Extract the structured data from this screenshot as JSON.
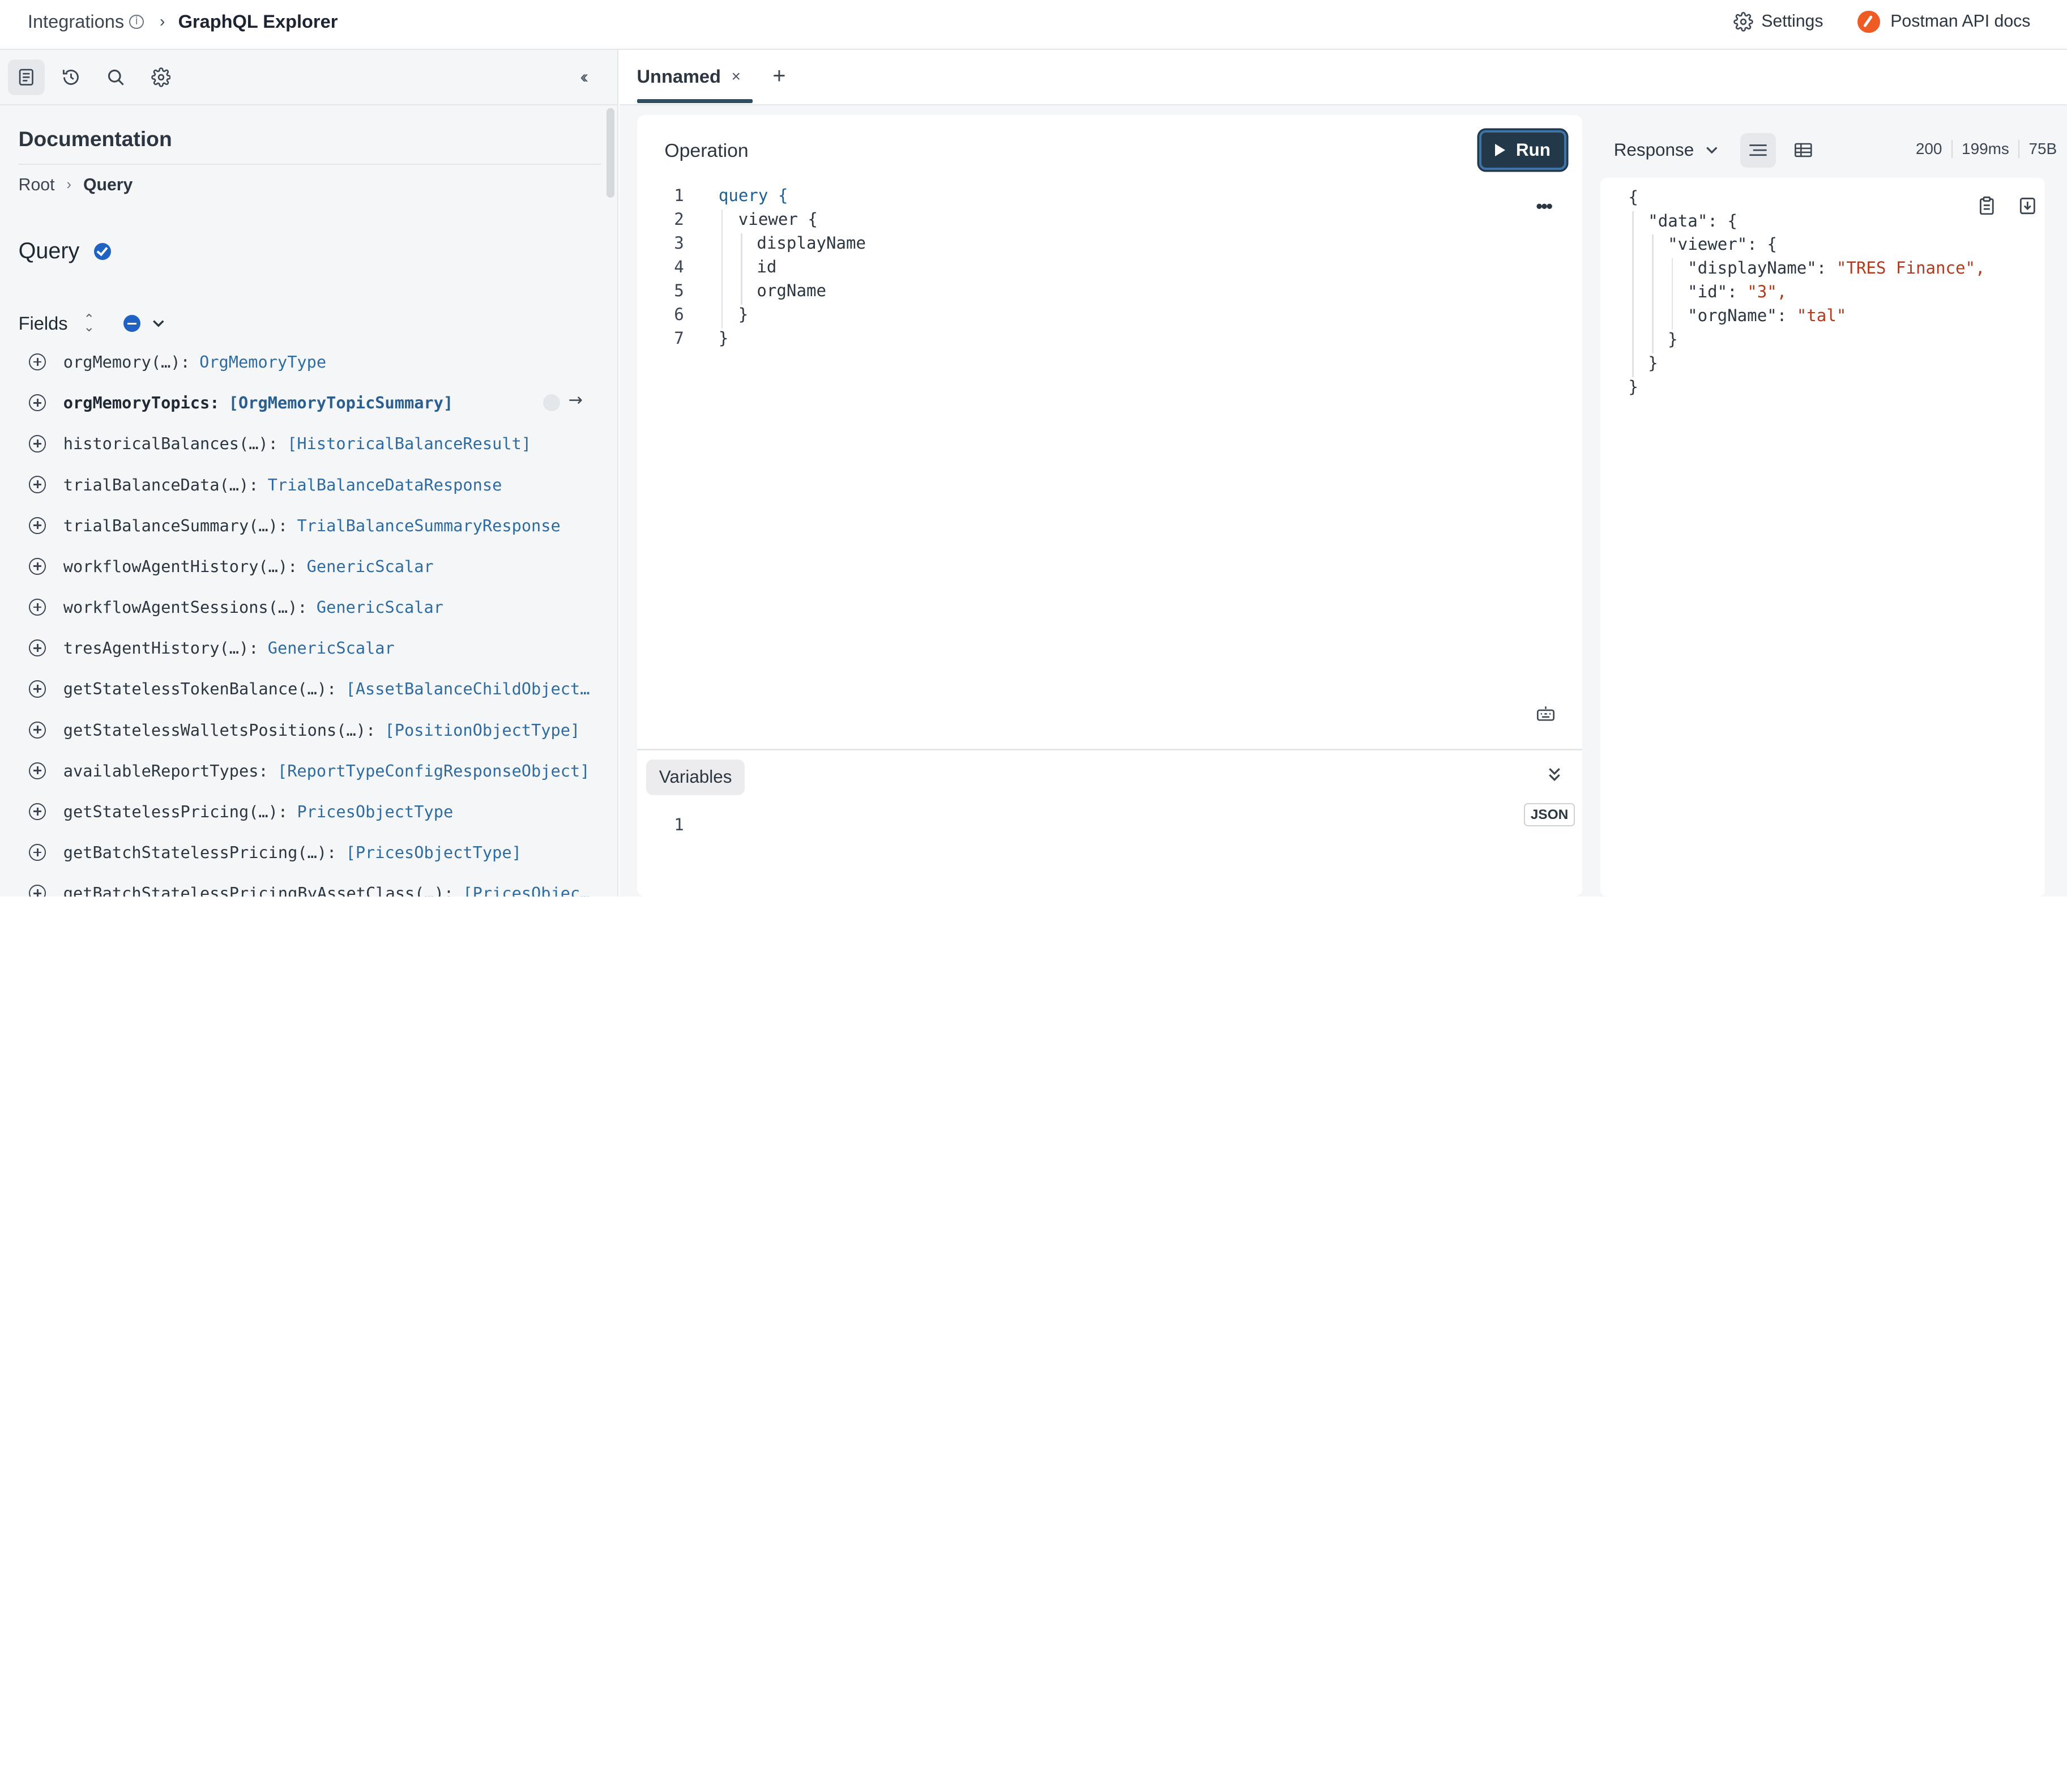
{
  "header": {
    "breadcrumb_root": "Integrations",
    "info_glyph": "i",
    "breadcrumb_current": "GraphQL Explorer",
    "settings_label": "Settings",
    "postman_label": "Postman API docs"
  },
  "sidebar": {
    "documentation_title": "Documentation",
    "breadcrumb": [
      "Root",
      "Query"
    ],
    "query_title": "Query",
    "fields_label": "Fields",
    "fields": [
      {
        "name": "orgMemory(…):",
        "type": "OrgMemoryType"
      },
      {
        "name": "orgMemoryTopics:",
        "type": "[OrgMemoryTopicSummary]"
      },
      {
        "name": "historicalBalances(…):",
        "type": "[HistoricalBalanceResult]"
      },
      {
        "name": "trialBalanceData(…):",
        "type": "TrialBalanceDataResponse"
      },
      {
        "name": "trialBalanceSummary(…):",
        "type": "TrialBalanceSummaryResponse"
      },
      {
        "name": "workflowAgentHistory(…):",
        "type": "GenericScalar"
      },
      {
        "name": "workflowAgentSessions(…):",
        "type": "GenericScalar"
      },
      {
        "name": "tresAgentHistory(…):",
        "type": "GenericScalar"
      },
      {
        "name": "getStatelessTokenBalance(…):",
        "type": "[AssetBalanceChildObject…"
      },
      {
        "name": "getStatelessWalletsPositions(…):",
        "type": "[PositionObjectType]"
      },
      {
        "name": "availableReportTypes:",
        "type": "[ReportTypeConfigResponseObject]"
      },
      {
        "name": "getStatelessPricing(…):",
        "type": "PricesObjectType"
      },
      {
        "name": "getBatchStatelessPricing(…):",
        "type": "[PricesObjectType]"
      },
      {
        "name": "getBatchStatelessPricingByAssetClass(…):",
        "type": "[PricesObjec…"
      }
    ]
  },
  "tabs": {
    "active_label": "Unnamed",
    "close_glyph": "×",
    "add_glyph": "+"
  },
  "operation": {
    "title": "Operation",
    "run_label": "Run",
    "more_glyph": "•••",
    "lines": [
      {
        "num": "1",
        "text": "query {"
      },
      {
        "num": "2",
        "text": "viewer {"
      },
      {
        "num": "3",
        "text": "displayName"
      },
      {
        "num": "4",
        "text": "id"
      },
      {
        "num": "5",
        "text": "orgName"
      },
      {
        "num": "6",
        "text": "}"
      },
      {
        "num": "7",
        "text": "}"
      }
    ],
    "variables_label": "Variables",
    "json_badge": "JSON",
    "variables_line": "1"
  },
  "response": {
    "label": "Response",
    "status": "200",
    "time": "199ms",
    "size": "75B",
    "lines": [
      {
        "k": "{",
        "v": ""
      },
      {
        "k": "\"data\": {",
        "v": ""
      },
      {
        "k": "\"viewer\": {",
        "v": ""
      },
      {
        "k": "\"displayName\": ",
        "v": "\"TRES Finance\","
      },
      {
        "k": "\"id\": ",
        "v": "\"3\","
      },
      {
        "k": "\"orgName\": ",
        "v": "\"tal\""
      },
      {
        "k": "}",
        "v": ""
      },
      {
        "k": "}",
        "v": ""
      },
      {
        "k": "}",
        "v": ""
      }
    ]
  },
  "colors": {
    "accent": "#1f62c4",
    "run_button": "#23394a",
    "keyword": "#1c5f92",
    "string": "#b33a1e",
    "type": "#2e6ba0",
    "postman": "#ef5b25"
  }
}
